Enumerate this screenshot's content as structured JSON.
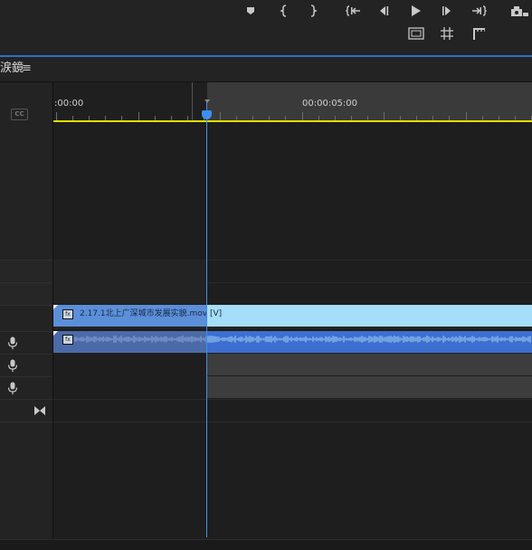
{
  "monitor": {
    "controls_row1": [
      "add-marker-icon",
      "mark-in-icon",
      "mark-out-icon",
      "go-to-in-icon",
      "step-back-icon",
      "play-icon",
      "step-forward-icon",
      "go-to-out-icon",
      "export-frame-icon"
    ],
    "controls_row2": [
      "safe-margins-icon",
      "grid-icon",
      "crop-icon"
    ]
  },
  "timeline": {
    "sequence_name": "涙鏡",
    "menu_glyph": "≡",
    "cc_label": "CC",
    "ruler": {
      "timecode_start": ":00:00",
      "timecode_mid": "00:00:05:00"
    },
    "video_clip": {
      "label": "2.17.1北上广深城市发展实貌.mov [V]",
      "fx": "fx"
    },
    "audio_clip": {
      "fx": "fx"
    }
  },
  "colors": {
    "accent_blue": "#3d8ff0",
    "video_clip": "#a5def8",
    "audio_clip": "#3c6fd0",
    "work_area": "#e0e000"
  }
}
